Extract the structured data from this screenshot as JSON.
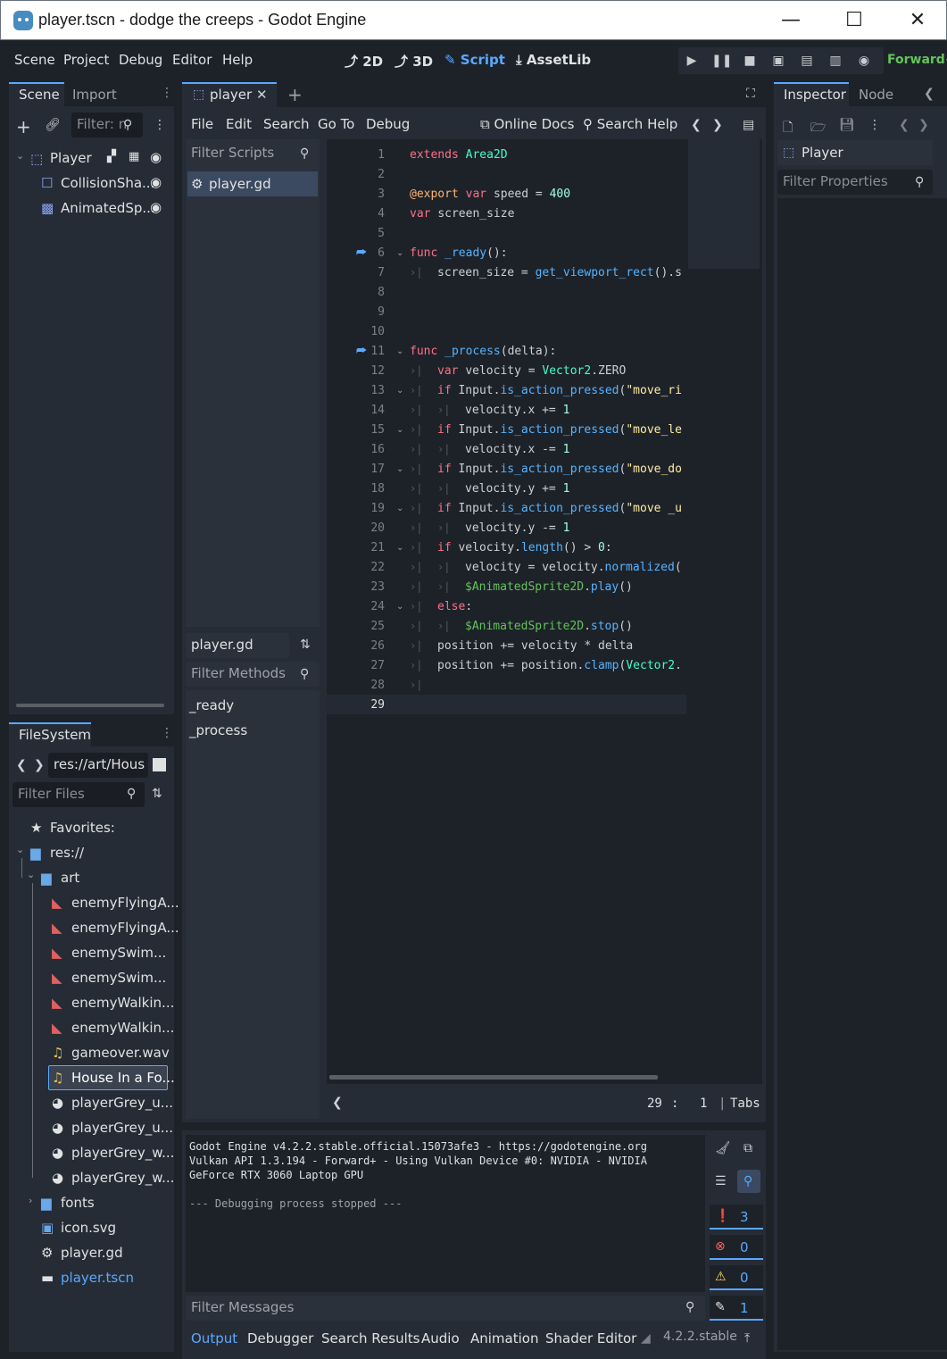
{
  "window": {
    "title": "player.tscn - dodge the creeps - Godot Engine",
    "minimize": "—",
    "maximize": "☐",
    "close": "✕"
  },
  "menu": {
    "scene": "Scene",
    "project": "Project",
    "debug": "Debug",
    "editor": "Editor",
    "help": "Help"
  },
  "workspaces": {
    "w2d": "2D",
    "w3d": "3D",
    "script": "Script",
    "assetlib": "AssetLib"
  },
  "renderer": "Forward+",
  "scene_dock": {
    "tabs": [
      "Scene",
      "Import"
    ],
    "filter_placeholder": "Filter: n",
    "tree": [
      {
        "label": "Player"
      },
      {
        "label": "CollisionSha..."
      },
      {
        "label": "AnimatedSp..."
      }
    ]
  },
  "filesystem": {
    "tab": "FileSystem",
    "path": "res://art/Hous",
    "filter_placeholder": "Filter Files",
    "items": [
      {
        "label": "Favorites:"
      },
      {
        "label": "res://"
      },
      {
        "label": "art"
      },
      {
        "label": "enemyFlyingA..."
      },
      {
        "label": "enemyFlyingA..."
      },
      {
        "label": "enemySwim..."
      },
      {
        "label": "enemySwim..."
      },
      {
        "label": "enemyWalkin..."
      },
      {
        "label": "enemyWalkin..."
      },
      {
        "label": "gameover.wav"
      },
      {
        "label": "House In a Fo..."
      },
      {
        "label": "playerGrey_u..."
      },
      {
        "label": "playerGrey_u..."
      },
      {
        "label": "playerGrey_w..."
      },
      {
        "label": "playerGrey_w..."
      },
      {
        "label": "fonts"
      },
      {
        "label": "icon.svg"
      },
      {
        "label": "player.gd"
      },
      {
        "label": "player.tscn"
      }
    ]
  },
  "script_editor": {
    "tab": "player",
    "menu": {
      "file": "File",
      "edit": "Edit",
      "search": "Search",
      "goto": "Go To",
      "debug": "Debug",
      "online_docs": "Online Docs",
      "search_help": "Search Help"
    },
    "filter_scripts": "Filter Scripts",
    "script_list": [
      "player.gd"
    ],
    "current_script": "player.gd",
    "filter_methods": "Filter Methods",
    "methods": [
      "_ready",
      "_process"
    ],
    "status": {
      "line": "29",
      "sep": ":",
      "col": "1",
      "indent": "Tabs"
    }
  },
  "code_lines": [
    {
      "n": "1"
    },
    {
      "n": "2"
    },
    {
      "n": "3"
    },
    {
      "n": "4"
    },
    {
      "n": "5"
    },
    {
      "n": "6"
    },
    {
      "n": "7"
    },
    {
      "n": "8"
    },
    {
      "n": "9"
    },
    {
      "n": "10"
    },
    {
      "n": "11"
    },
    {
      "n": "12"
    },
    {
      "n": "13"
    },
    {
      "n": "14"
    },
    {
      "n": "15"
    },
    {
      "n": "16"
    },
    {
      "n": "17"
    },
    {
      "n": "18"
    },
    {
      "n": "19"
    },
    {
      "n": "20"
    },
    {
      "n": "21"
    },
    {
      "n": "22"
    },
    {
      "n": "23"
    },
    {
      "n": "24"
    },
    {
      "n": "25"
    },
    {
      "n": "26"
    },
    {
      "n": "27"
    },
    {
      "n": "28"
    },
    {
      "n": "29"
    }
  ],
  "code_text": {
    "l1a": "extends",
    "l1b": "Area2D",
    "l3a": "@export",
    "l3b": "var",
    "l3c": "speed = ",
    "l3d": "400",
    "l4a": "var",
    "l4b": "screen_size",
    "l6a": "func",
    "l6b": "_ready",
    "l7a": "screen_size = ",
    "l7b": "get_viewport_rect",
    "l7c": "().s",
    "l11a": "func",
    "l11b": "_process",
    "l11c": "(delta):",
    "l12a": "var",
    "l12b": "velocity = ",
    "l12c": "Vector2",
    "l12d": ".ZERO",
    "l13a": "if",
    "l13b": "Input.",
    "l13c": "is_action_pressed",
    "l13d": "(",
    "l13e": "\"move_ri",
    "l14a": "velocity.x += ",
    "l14b": "1",
    "l15a": "if",
    "l15b": "Input.",
    "l15c": "is_action_pressed",
    "l15d": "(",
    "l15e": "\"move_le",
    "l16a": "velocity.x -= ",
    "l16b": "1",
    "l17a": "if",
    "l17b": "Input.",
    "l17c": "is_action_pressed",
    "l17d": "(",
    "l17e": "\"move_do",
    "l18a": "velocity.y += ",
    "l18b": "1",
    "l19a": "if",
    "l19b": "Input.",
    "l19c": "is_action_pressed",
    "l19d": "(",
    "l19e": "\"move _u",
    "l20a": "velocity.y -= ",
    "l20b": "1",
    "l21a": "if",
    "l21b": "velocity.",
    "l21c": "length",
    "l21d": "() > ",
    "l21e": "0",
    "l22a": "velocity = velocity.",
    "l22b": "normalized",
    "l23a": "$AnimatedSprite2D",
    "l23b": ".",
    "l23c": "play",
    "l24a": "else",
    "l25a": "$AnimatedSprite2D",
    "l25b": ".",
    "l25c": "stop",
    "l26a": "position += velocity * delta",
    "l27a": "position += position.",
    "l27b": "clamp",
    "l27c": "(",
    "l27d": "Vector2",
    "l27e": "."
  },
  "inspector": {
    "tabs": [
      "Inspector",
      "Node"
    ],
    "object": "Player",
    "filter_placeholder": "Filter Properties"
  },
  "output": {
    "lines": [
      "Godot Engine v4.2.2.stable.official.15073afe3 - https://godotengine.org",
      "Vulkan API 1.3.194 - Forward+ - Using Vulkan Device #0: NVIDIA - NVIDIA",
      "GeForce RTX 3060 Laptop GPU",
      "",
      "--- Debugging process stopped ---"
    ],
    "filter_placeholder": "Filter Messages",
    "counts": {
      "messages": "3",
      "errors": "0",
      "warnings": "0",
      "editor": "1"
    }
  },
  "bottom_tabs": [
    "Output",
    "Debugger",
    "Search Results",
    "Audio",
    "Animation",
    "Shader Editor"
  ],
  "version": "4.2.2.stable"
}
